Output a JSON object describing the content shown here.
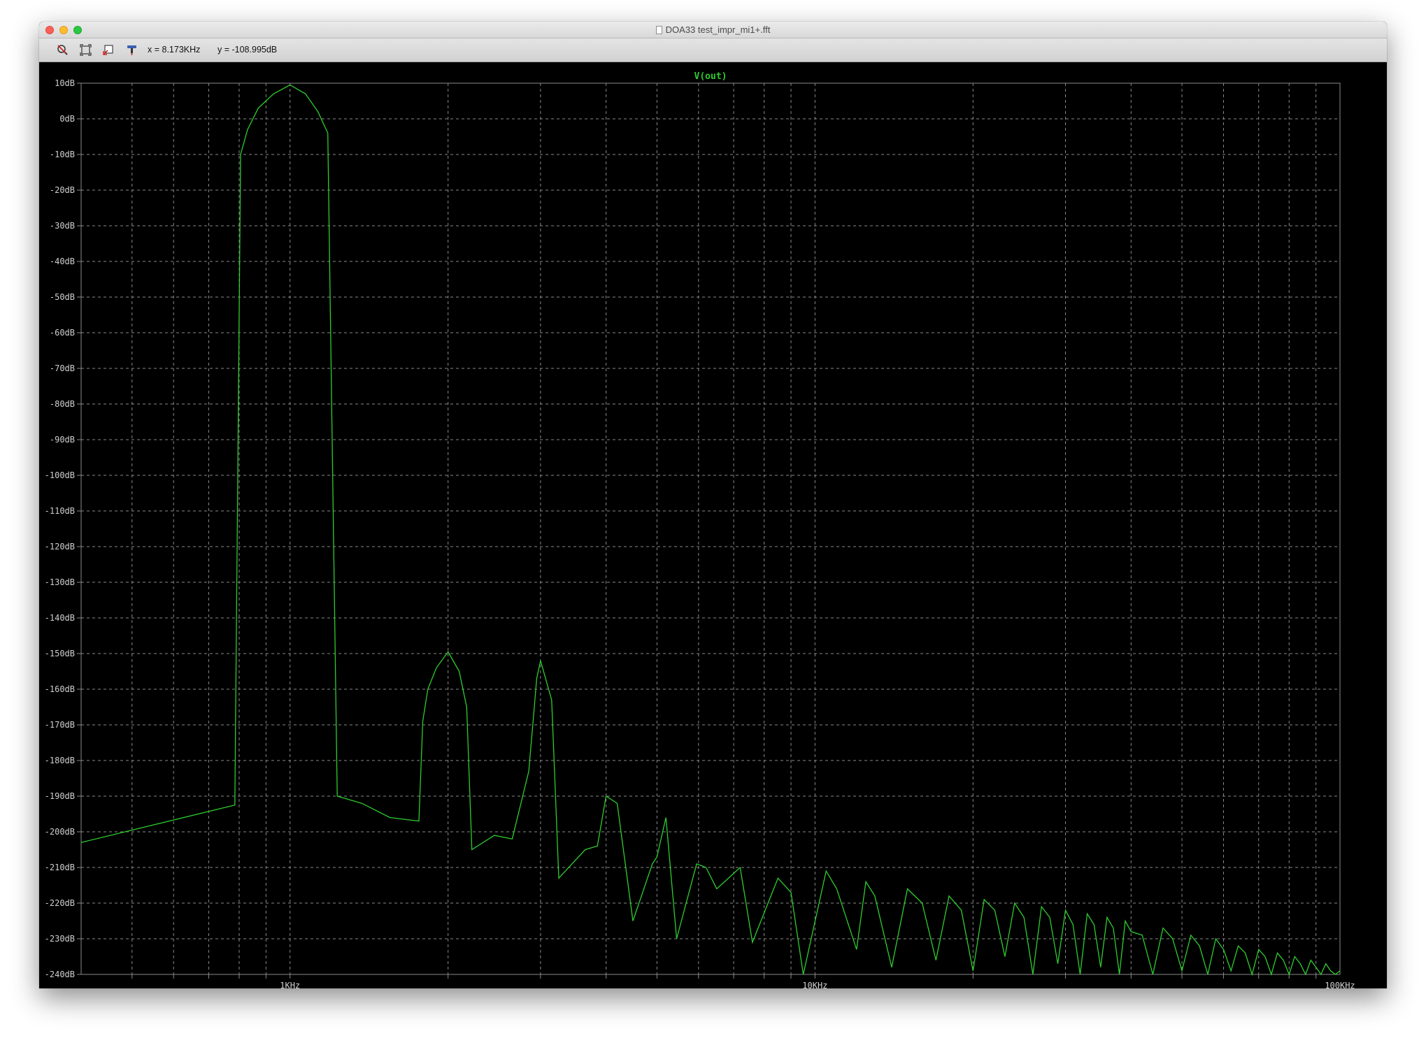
{
  "window": {
    "title": "DOA33 test_impr_mi1+.fft"
  },
  "toolbar": {
    "x_readout": "x = 8.173KHz",
    "y_readout": "y = -108.995dB",
    "icons": [
      "zoom-cancel-icon",
      "zoom-extents-icon",
      "autorange-icon",
      "probe-icon"
    ]
  },
  "colors": {
    "trace": "#2ecc2e",
    "grid": "#8a8a8a",
    "background": "#000000",
    "axis_text": "#cfcfcf"
  },
  "chart_data": {
    "type": "line",
    "title": "V(out)",
    "xlabel": "",
    "ylabel": "",
    "x_scale": "log",
    "xlim": [
      400,
      100000
    ],
    "ylim": [
      -240,
      10
    ],
    "grid": true,
    "x_tick_labels": [
      {
        "value": 1000,
        "label": "1KHz"
      },
      {
        "value": 10000,
        "label": "10KHz"
      },
      {
        "value": 100000,
        "label": "100KHz"
      }
    ],
    "y_tick_labels": [
      "10dB",
      "0dB",
      "-10dB",
      "-20dB",
      "-30dB",
      "-40dB",
      "-50dB",
      "-60dB",
      "-70dB",
      "-80dB",
      "-90dB",
      "-100dB",
      "-110dB",
      "-120dB",
      "-130dB",
      "-140dB",
      "-150dB",
      "-160dB",
      "-170dB",
      "-180dB",
      "-190dB",
      "-200dB",
      "-210dB",
      "-220dB",
      "-230dB",
      "-240dB"
    ],
    "series": [
      {
        "name": "V(out)",
        "x": [
          400,
          785,
          805,
          830,
          870,
          930,
          1000,
          1070,
          1130,
          1180,
          1230,
          1370,
          1550,
          1760,
          1790,
          1830,
          1900,
          2000,
          2100,
          2170,
          2220,
          2450,
          2650,
          2850,
          2920,
          2950,
          3000,
          3150,
          3250,
          3650,
          3850,
          4000,
          4200,
          4500,
          4900,
          5000,
          5200,
          5450,
          5950,
          6200,
          6500,
          7200,
          7600,
          8500,
          9000,
          9500,
          10500,
          11000,
          12000,
          12500,
          13000,
          14000,
          15000,
          16000,
          17000,
          18000,
          19000,
          20000,
          21000,
          22000,
          23000,
          24000,
          25000,
          26000,
          27000,
          28000,
          29000,
          30000,
          31000,
          32000,
          33000,
          34000,
          35000,
          36000,
          37000,
          38000,
          39000,
          40000,
          42000,
          44000,
          46000,
          48000,
          50000,
          52000,
          54000,
          56000,
          58000,
          60000,
          62000,
          64000,
          66000,
          68000,
          70000,
          72000,
          74000,
          76000,
          78000,
          80000,
          82000,
          84000,
          86000,
          88000,
          90000,
          92000,
          94000,
          96000,
          98000,
          100000
        ],
        "y": [
          -203,
          -192.5,
          -10,
          -3,
          3,
          7,
          9.5,
          7,
          2,
          -4,
          -190,
          -192,
          -196,
          -197,
          -169,
          -160,
          -154,
          -149.5,
          -155,
          -165,
          -205,
          -201,
          -202,
          -183,
          -165,
          -157,
          -152,
          -163,
          -213,
          -205,
          -204,
          -190,
          -192,
          -225,
          -209,
          -207,
          -196,
          -230,
          -209,
          -210,
          -216,
          -210,
          -231,
          -213,
          -217,
          -240,
          -211,
          -216,
          -233,
          -214,
          -218,
          -238,
          -216,
          -220,
          -236,
          -218,
          -222,
          -239,
          -219,
          -222,
          -235,
          -220,
          -224,
          -240,
          -221,
          -224,
          -237,
          -222,
          -226,
          -240,
          -223,
          -226,
          -238,
          -224,
          -227,
          -240,
          -225,
          -228,
          -229,
          -240,
          -227,
          -230,
          -239,
          -229,
          -232,
          -240,
          -230,
          -233,
          -239,
          -232,
          -234,
          -240,
          -233,
          -235,
          -240,
          -234,
          -236,
          -240,
          -235,
          -237,
          -240,
          -236,
          -238,
          -240,
          -237,
          -239,
          -240,
          -239
        ]
      }
    ]
  }
}
